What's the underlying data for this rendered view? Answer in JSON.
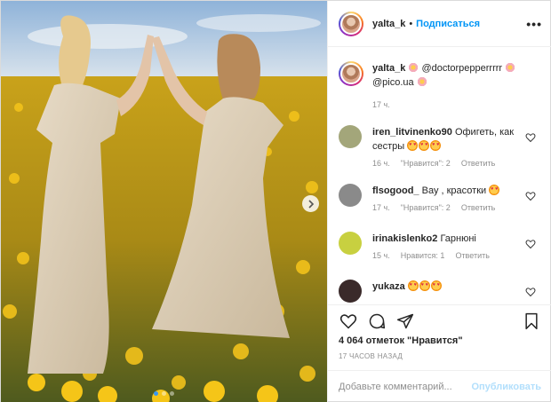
{
  "post": {
    "author": "yalta_k",
    "separator": "•",
    "follow_label": "Подписаться",
    "more_icon": "more-horizontal-icon",
    "more_label": "•••"
  },
  "caption": {
    "username": "yalta_k",
    "mention1": "@doctorpepperrrrr",
    "mention2": "@pico.ua",
    "time": "17 ч."
  },
  "comments": [
    {
      "username": "iren_litvinenko90",
      "text": "Офигеть, как сестры",
      "time": "16 ч.",
      "likes": "\"Нравится\": 2",
      "reply": "Ответить",
      "avatar_color": "#a3a67a"
    },
    {
      "username": "flsogood_",
      "text": "Вау , красотки",
      "time": "17 ч.",
      "likes": "\"Нравится\": 2",
      "reply": "Ответить",
      "avatar_color": "#8a8a8a"
    },
    {
      "username": "irinakislenko2",
      "text": "Гарнюні",
      "time": "15 ч.",
      "likes": "Нравится: 1",
      "reply": "Ответить",
      "avatar_color": "#c8d040"
    },
    {
      "username": "yukaza",
      "text": "",
      "avatar_color": "#3a2a2a"
    }
  ],
  "stats": {
    "likes_count": "4 064 отметок \"Нравится\"",
    "posted": "17 ЧАСОВ НАЗАД"
  },
  "add_comment": {
    "placeholder": "Добавьте комментарий...",
    "publish_label": "Опубликовать"
  },
  "colors": {
    "accent": "#0095f6",
    "publish_disabled": "#b2dffc",
    "muted": "#8e8e8e"
  },
  "carousel": {
    "current": 1,
    "total": 3
  }
}
